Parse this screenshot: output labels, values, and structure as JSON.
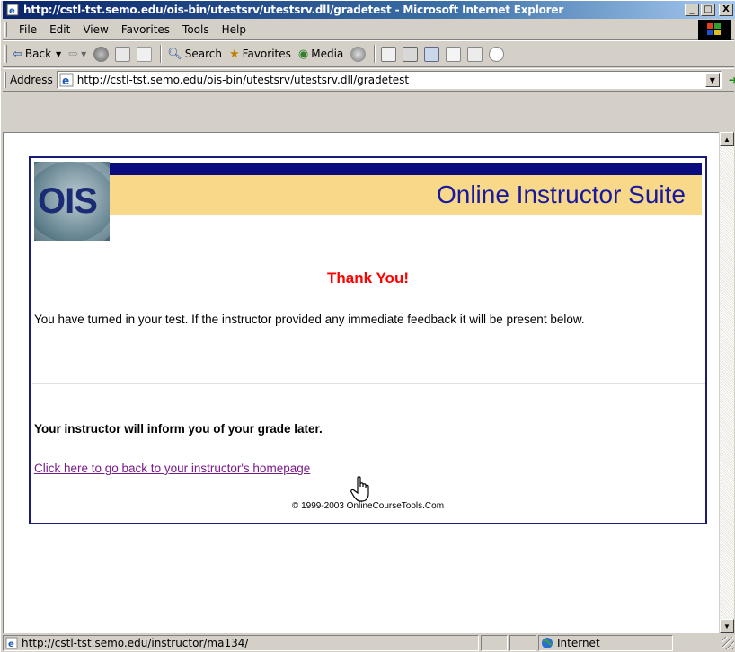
{
  "window": {
    "title": "http://cstl-tst.semo.edu/ois-bin/utestsrv/utestsrv.dll/gradetest - Microsoft Internet Explorer",
    "minimize": "_",
    "maximize": "□",
    "close": "X"
  },
  "menu": {
    "items": [
      "File",
      "Edit",
      "View",
      "Favorites",
      "Tools",
      "Help"
    ]
  },
  "toolbar": {
    "back_label": "Back",
    "search_label": "Search",
    "favorites_label": "Favorites",
    "media_label": "Media"
  },
  "address": {
    "label": "Address",
    "url": "http://cstl-tst.semo.edu/ois-bin/utestsrv/utestsrv.dll/gradetest",
    "go_label": "Go"
  },
  "page": {
    "logo_text": "OIS",
    "suite_title": "Online Instructor Suite",
    "thank_you": "Thank You!",
    "message": "You have turned in your test.  If the instructor provided any immediate feedback it will be present below.",
    "grade_note": "Your instructor will inform you of your grade later.",
    "home_link": "Click here to go back to your instructor's homepage",
    "copyright": "© 1999-2003 OnlineCourseTools.Com"
  },
  "status": {
    "url": "http://cstl-tst.semo.edu/instructor/ma134/",
    "zone": "Internet"
  },
  "colors": {
    "title_red": "#ff0000",
    "navy": "#0b0b80",
    "tan": "#f8d98a",
    "link_purple": "#7a1a8a"
  }
}
